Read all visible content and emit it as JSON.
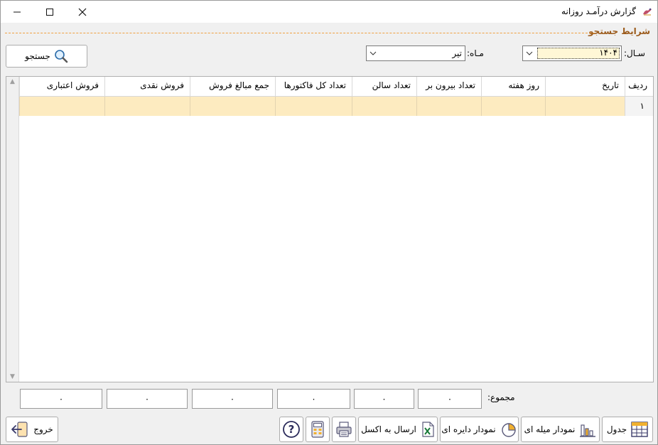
{
  "window": {
    "title": "گزارش درآمـد روزانه",
    "min_symbol": "—",
    "max_symbol": "☐",
    "close_symbol": "✕"
  },
  "search_group": {
    "title": "شرایط جستجو",
    "year_label": "سـال:",
    "year_value": "۱۴۰۴",
    "month_label": "مـاه:",
    "month_value": "تیر",
    "search_button": "جستجو"
  },
  "grid": {
    "columns": [
      {
        "label": "ردیف",
        "width": 40
      },
      {
        "label": "تاریخ",
        "width": 112
      },
      {
        "label": "روز هفته",
        "width": 90
      },
      {
        "label": "تعداد بیرون بر",
        "width": 91
      },
      {
        "label": "تعداد سالن",
        "width": 91
      },
      {
        "label": "تعداد کل فاکتورها",
        "width": 108
      },
      {
        "label": "جمع مبالغ فروش",
        "width": 120
      },
      {
        "label": "فروش نقدی",
        "width": 120
      },
      {
        "label": "فروش اعتباری",
        "width": 120
      }
    ],
    "rows": [
      {
        "cells": [
          "۱",
          "",
          "",
          "",
          "",
          "",
          "",
          "",
          ""
        ]
      }
    ]
  },
  "totals": {
    "label": "مجموع:",
    "values": [
      "۰",
      "۰",
      "۰",
      "۰",
      "۰",
      "۰"
    ]
  },
  "toolbar": {
    "table": "جدول",
    "bar_chart": "نمودار میله ای",
    "pie_chart": "نمودار دایره ای",
    "excel": "ارسال به اکسل",
    "exit": "خروج"
  },
  "colors": {
    "accent": "#9b5a1a",
    "dashed_line": "#f0a040",
    "row_highlight": "#fdebc0",
    "window_bg": "#f0f0f0"
  }
}
